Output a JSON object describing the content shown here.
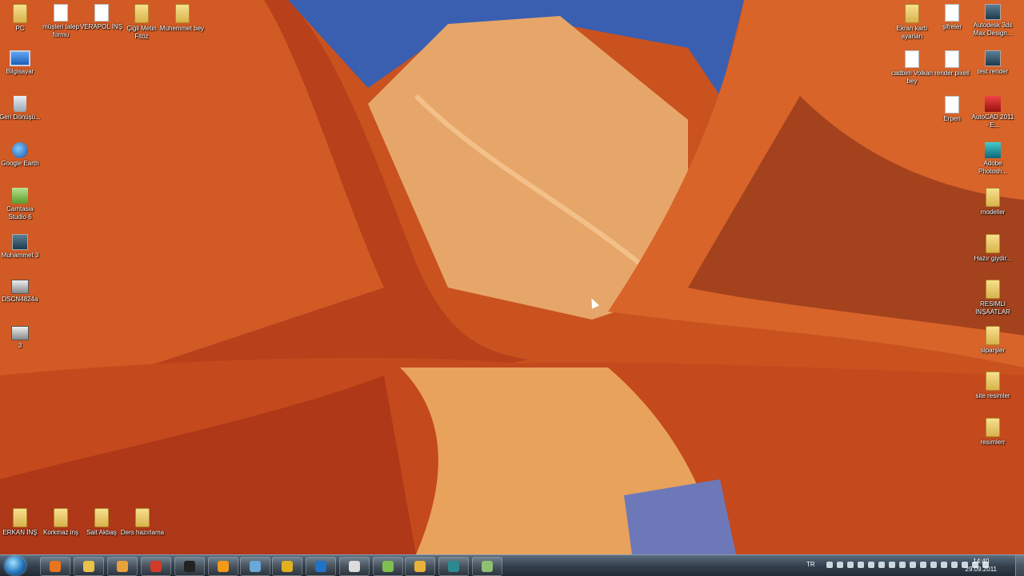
{
  "desktop": {
    "icons_left": [
      {
        "label": "PC",
        "glyph": "g-folder",
        "icon": "folder-icon"
      },
      {
        "label": "Bilgisayar",
        "glyph": "g-pc",
        "icon": "computer-icon"
      },
      {
        "label": "Geri Dönüşü...",
        "glyph": "g-bin",
        "icon": "recycle-bin-icon"
      },
      {
        "label": "Google Earth",
        "glyph": "g-earth",
        "icon": "globe-icon"
      },
      {
        "label": "Camtasia Studio 6",
        "glyph": "g-green",
        "icon": "camtasia-icon"
      },
      {
        "label": "Muhammet 3",
        "glyph": "g-app",
        "icon": "3dsmax-file-icon"
      },
      {
        "label": "DSCN4824a",
        "glyph": "g-img",
        "icon": "video-file-icon"
      },
      {
        "label": "3",
        "glyph": "g-img",
        "icon": "image-file-icon"
      }
    ],
    "icons_top": [
      {
        "label": "müşteri talep formu",
        "glyph": "g-doc",
        "icon": "document-icon"
      },
      {
        "label": "VERAPOL İNŞ",
        "glyph": "g-doc",
        "icon": "document-icon"
      },
      {
        "label": "Çiğli Metin Fitöz",
        "glyph": "g-folder",
        "icon": "folder-icon"
      },
      {
        "label": "Muhemmet bey",
        "glyph": "g-folder",
        "icon": "folder-icon"
      }
    ],
    "icons_bottom": [
      {
        "label": "ERKAN İNŞ",
        "glyph": "g-folder",
        "icon": "folder-icon"
      },
      {
        "label": "Korkmaz inş",
        "glyph": "g-folder",
        "icon": "folder-icon"
      },
      {
        "label": "Sait Akbaş",
        "glyph": "g-folder",
        "icon": "folder-icon"
      },
      {
        "label": "Ders hazırlama",
        "glyph": "g-folder",
        "icon": "folder-icon"
      }
    ],
    "icons_right_col1": [
      {
        "label": "Ekran kartı ayarları",
        "glyph": "g-folder",
        "icon": "folder-icon"
      },
      {
        "label": "cadbim Volkan bey",
        "glyph": "g-doc",
        "icon": "document-icon"
      }
    ],
    "icons_right_col2": [
      {
        "label": "şifreler",
        "glyph": "g-doc",
        "icon": "document-icon"
      },
      {
        "label": "render pixell",
        "glyph": "g-doc",
        "icon": "document-icon"
      },
      {
        "label": "Erpen",
        "glyph": "g-doc",
        "icon": "document-icon"
      }
    ],
    "icons_right_col3": [
      {
        "label": "Autodesk 3ds Max Design...",
        "glyph": "g-app",
        "icon": "3dsmax-icon"
      },
      {
        "label": "test render",
        "glyph": "g-app",
        "icon": "3dsmax-file-icon"
      },
      {
        "label": "AutoCAD 2011 - E...",
        "glyph": "g-red",
        "icon": "autocad-icon"
      },
      {
        "label": "Adobe Photosh...",
        "glyph": "g-blue",
        "icon": "photoshop-icon"
      },
      {
        "label": "modeller",
        "glyph": "g-folder",
        "icon": "folder-icon"
      },
      {
        "label": "Hazır giydir...",
        "glyph": "g-folder",
        "icon": "folder-icon"
      },
      {
        "label": "RESIMLI İNŞAATLAR",
        "glyph": "g-folder",
        "icon": "folder-icon"
      },
      {
        "label": "siparşler",
        "glyph": "g-folder",
        "icon": "folder-icon"
      },
      {
        "label": "site resimler",
        "glyph": "g-folder",
        "icon": "folder-icon"
      },
      {
        "label": "resimlerr",
        "glyph": "g-folder",
        "icon": "folder-icon"
      }
    ]
  },
  "taskbar": {
    "pinned": [
      {
        "name": "firefox-icon",
        "color": "#e8741f"
      },
      {
        "name": "explorer-icon",
        "color": "#e9c24a"
      },
      {
        "name": "media-player-icon",
        "color": "#e9a23a"
      },
      {
        "name": "app-red-icon",
        "color": "#d23a2a"
      },
      {
        "name": "app-dark-icon",
        "color": "#222222"
      },
      {
        "name": "app-orange-icon",
        "color": "#f39a1a"
      },
      {
        "name": "network-icon",
        "color": "#6aa8d8"
      },
      {
        "name": "app-green-icon",
        "color": "#e0b020"
      },
      {
        "name": "teamviewer-icon",
        "color": "#1f73c8"
      },
      {
        "name": "app-white-icon",
        "color": "#dddddd"
      },
      {
        "name": "notepad-icon",
        "color": "#7fbf50"
      },
      {
        "name": "outlook-icon",
        "color": "#e9b23a"
      },
      {
        "name": "3dsmax-icon",
        "color": "#2a8a90"
      },
      {
        "name": "app-folder-icon",
        "color": "#8fc070"
      }
    ],
    "language": "TR",
    "time": "14:40",
    "date": "29.09.2011"
  }
}
